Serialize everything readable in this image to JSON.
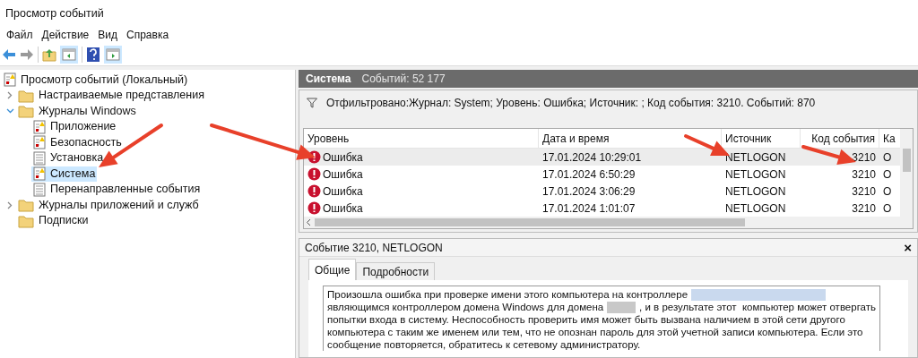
{
  "window": {
    "title": "Просмотр событий"
  },
  "menu": [
    "Файл",
    "Действие",
    "Вид",
    "Справка"
  ],
  "tree": [
    {
      "label": "Просмотр событий (Локальный)",
      "kind": "warning-log",
      "children": [
        {
          "label": "Настраиваемые представления",
          "kind": "folder",
          "selected": false,
          "expanded": false
        },
        {
          "label": "Журналы Windows",
          "kind": "folder",
          "selected": false,
          "expanded": true,
          "children": [
            {
              "label": "Приложение",
              "kind": "warning-log",
              "selected": false
            },
            {
              "label": "Безопасность",
              "kind": "warning-log",
              "selected": false
            },
            {
              "label": "Установка",
              "kind": "plain-log",
              "selected": false
            },
            {
              "label": "Система",
              "kind": "warning-log",
              "selected": true
            },
            {
              "label": "Перенаправленные события",
              "kind": "plain-log",
              "selected": false
            }
          ]
        },
        {
          "label": "Журналы приложений и служб",
          "kind": "folder",
          "selected": false,
          "expanded": false
        },
        {
          "label": "Подписки",
          "kind": "folder",
          "selected": false
        }
      ]
    }
  ],
  "pane_header": {
    "title": "Система",
    "count": "Событий: 52 177"
  },
  "filter": "Отфильтровано:Журнал: System; Уровень: Ошибка; Источник: ; Код события: 3210. Событий: 870",
  "table": {
    "columns": [
      "Уровень",
      "Дата и время",
      "Источник",
      "Код события",
      "Ка"
    ],
    "rows": [
      {
        "level": "Ошибка",
        "date": "17.01.2024 10:29:01",
        "source": "NETLOGON",
        "code": "3210",
        "column_5": "О",
        "selected": true
      },
      {
        "level": "Ошибка",
        "date": "17.01.2024 6:50:29",
        "source": "NETLOGON",
        "code": "3210",
        "column_5": "О",
        "selected": false
      },
      {
        "level": "Ошибка",
        "date": "17.01.2024 3:06:29",
        "source": "NETLOGON",
        "code": "3210",
        "column_5": "О",
        "selected": false
      },
      {
        "level": "Ошибка",
        "date": "17.01.2024 1:01:07",
        "source": "NETLOGON",
        "code": "3210",
        "column_5": "О",
        "selected": false
      }
    ]
  },
  "detail": {
    "title": "Событие 3210, NETLOGON",
    "close": "×",
    "tabs": [
      {
        "label": "Общие",
        "selected": true
      },
      {
        "label": "Подробности",
        "selected": false
      }
    ],
    "description": [
      [
        {
          "kind": "text",
          "text": "Произошла ошибка при проверке имени этого компьютера на контроллере"
        },
        {
          "kind": "redacted"
        }
      ],
      [
        {
          "kind": "text",
          "text": "являющимся контроллером домена Windows для домена"
        },
        {
          "kind": "redacted"
        },
        {
          "kind": "text",
          "text": ", и в результате этот  компьютер может отвергать"
        }
      ],
      [
        {
          "kind": "text",
          "text": "попытки входа в систему. Неспособность проверить имя может быть вызвана наличием в этой сети другого"
        }
      ],
      [
        {
          "kind": "text",
          "text": "компьютера с таким же именем или тем, что не опознан пароль для этой учетной записи компьютера. Если это"
        }
      ],
      [
        {
          "kind": "text",
          "text": "сообщение повторяется, обратитесь к сетевому администратору."
        }
      ]
    ]
  }
}
